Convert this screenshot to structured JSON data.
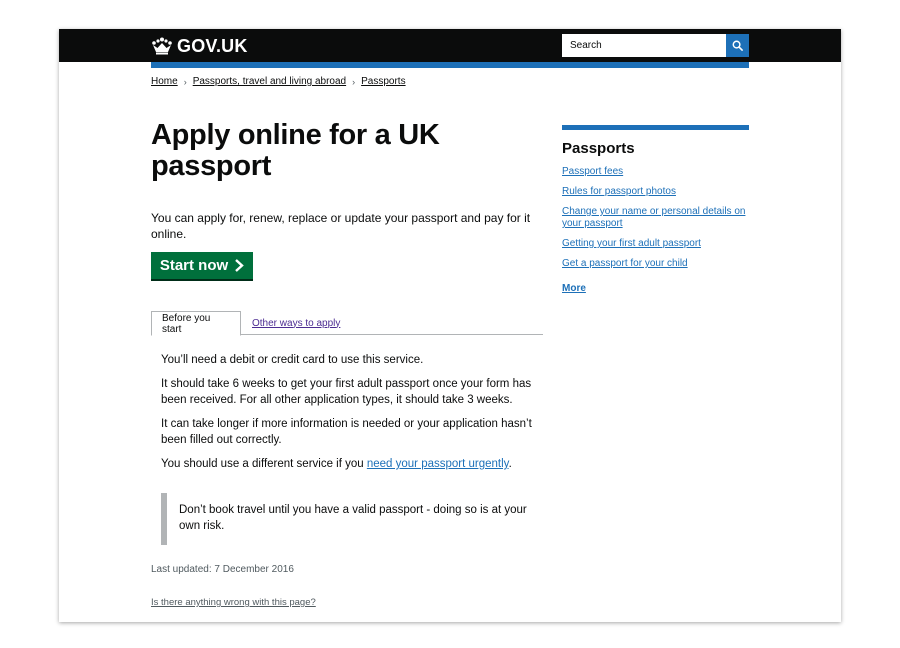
{
  "header": {
    "logo_text": "GOV.UK",
    "search_placeholder": "Search"
  },
  "breadcrumb": [
    "Home",
    "Passports, travel and living abroad",
    "Passports"
  ],
  "main": {
    "title": "Apply online for a UK passport",
    "lead": "You can apply for, renew, replace or update your passport and pay for it online.",
    "start_button": "Start now",
    "tabs": [
      {
        "label": "Before you start",
        "active": true
      },
      {
        "label": "Other ways to apply",
        "active": false
      }
    ],
    "paragraphs": [
      "You’ll need a debit or credit card to use this service.",
      "It should take 6 weeks to get your first adult passport once your form has been received. For all other application types, it should take 3 weeks.",
      "It can take longer if more information is needed or your application hasn’t been filled out correctly."
    ],
    "urgent_prefix": "You should use a different service if you ",
    "urgent_link": "need your passport urgently",
    "urgent_suffix": ".",
    "inset": "Don’t book travel until you have a valid passport - doing so is at your own risk.",
    "last_updated": "Last updated: 7 December 2016",
    "report_link": "Is there anything wrong with this page?"
  },
  "sidebar": {
    "title": "Passports",
    "links": [
      "Passport fees",
      "Rules for passport photos",
      "Change your name or personal details on your passport",
      "Getting your first adult passport",
      "Get a passport for your child"
    ],
    "more": "More"
  },
  "colors": {
    "header_bg": "#0b0c0c",
    "brand_blue": "#1d70b8",
    "start_green": "#00703c",
    "visited_purple": "#4c2c92",
    "inset_border": "#b1b4b6"
  },
  "icons": [
    "crown-icon",
    "search-icon",
    "chevron-right-icon"
  ]
}
